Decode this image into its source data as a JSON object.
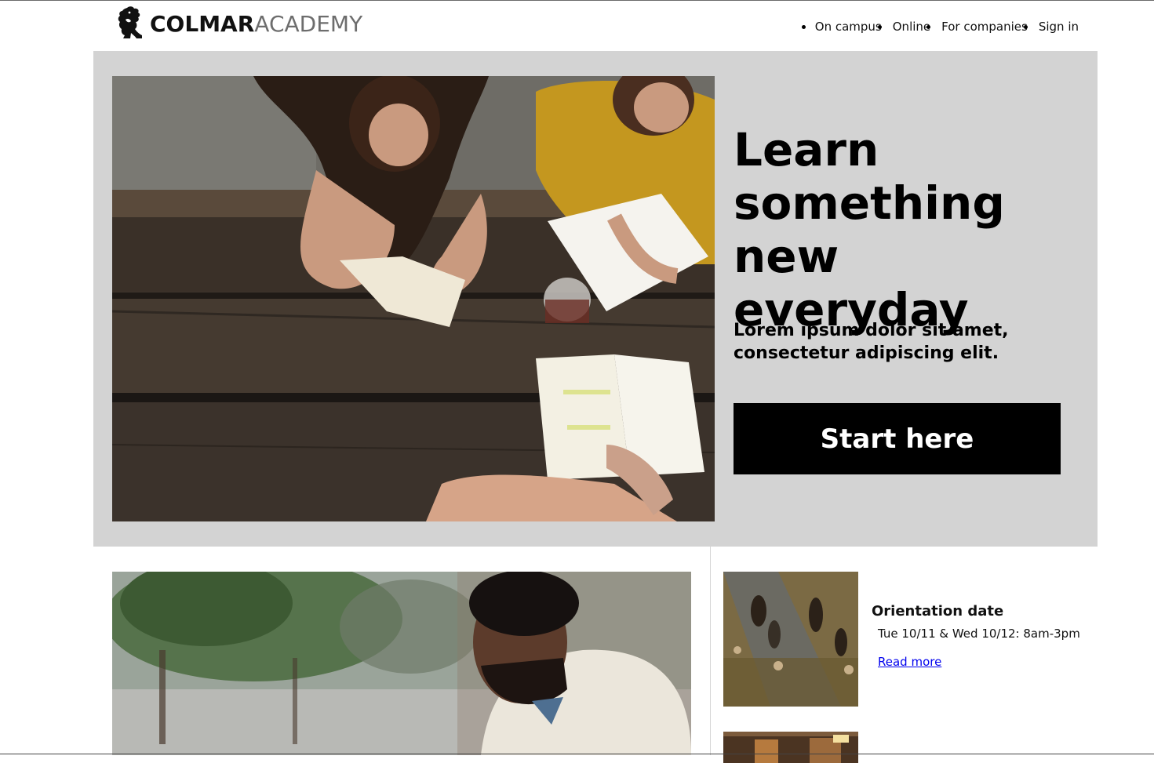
{
  "brand": {
    "name_bold": "COLMAR",
    "name_light": "ACADEMY",
    "icon": "griffin-logo-icon"
  },
  "nav": {
    "items": [
      {
        "label": "On campus"
      },
      {
        "label": "Online"
      },
      {
        "label": "For companies"
      },
      {
        "label": "Sign in"
      }
    ]
  },
  "hero": {
    "heading": "Learn something new everyday",
    "subheading": "Lorem ipsum dolor sit amet, consectetur adipiscing elit.",
    "cta_label": "Start here",
    "background": "#d3d3d3"
  },
  "event": {
    "title": "Orientation date",
    "date": "Tue 10/11 & Wed 10/12: 8am-3pm",
    "link_label": "Read more"
  },
  "colors": {
    "link": "#0000ee",
    "cta_background": "#000000",
    "cta_text": "#ffffff"
  }
}
